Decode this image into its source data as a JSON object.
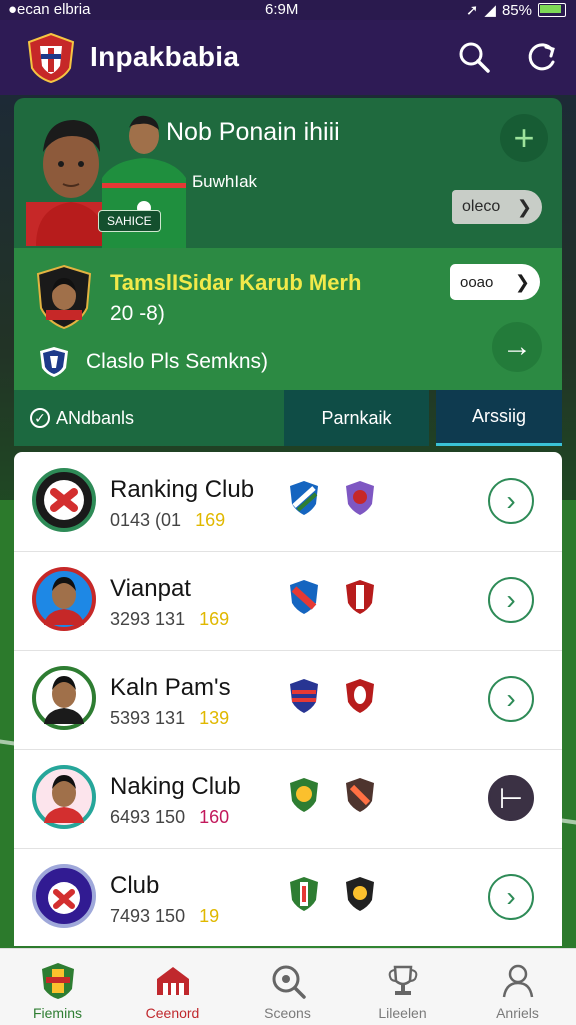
{
  "status_bar": {
    "carrier": "●ecan elbria",
    "time": "6:9M",
    "battery": "85%",
    "battery_level": 0.85
  },
  "app": {
    "title": "Inpakbabia"
  },
  "hero": {
    "title": "Nob Ponain ihiii",
    "subtitle": "ƂuwhIak",
    "player_tag": "SAHICE",
    "pill_label": "oleco"
  },
  "match": {
    "title": "TamslISidar Karub Merh",
    "score": "20 -8)",
    "watch_label": "ooao",
    "league": "Claslo Pls Semkns)"
  },
  "tabs": [
    {
      "label": "ANdbanls"
    },
    {
      "label": "Parnkaik"
    },
    {
      "label": "Arssiig"
    }
  ],
  "rows": [
    {
      "name": "Ranking Club",
      "stat_a": "0143 (01",
      "stat_b": "169",
      "highlight_color": "#e0b800"
    },
    {
      "name": "Vianpat",
      "stat_a": "3293 131",
      "stat_b": "169",
      "highlight_color": "#e0b800"
    },
    {
      "name": "Kaln Pam's",
      "stat_a": "5393 131",
      "stat_b": "139",
      "highlight_color": "#e0b800"
    },
    {
      "name": "Naking Club",
      "stat_a": "6493 150",
      "stat_b": "160",
      "highlight_color": "#c2185b"
    },
    {
      "name": "Club",
      "stat_a": "7493 150",
      "stat_b": "19",
      "highlight_color": "#e0b800"
    }
  ],
  "nav": [
    {
      "label": "Fiemins",
      "icon": "team-badge-icon"
    },
    {
      "label": "Ceenord",
      "icon": "stadium-icon"
    },
    {
      "label": "Sceons",
      "icon": "search-ball-icon"
    },
    {
      "label": "Lileelen",
      "icon": "trophy-icon"
    },
    {
      "label": "Anriels",
      "icon": "profile-icon"
    }
  ],
  "colors": {
    "appbar": "#2e1b55",
    "hero": "#1f6a3e",
    "match": "#2c8a43",
    "accent_yellow": "#f2e94a",
    "arrow_green": "#2e8b57",
    "active_red": "#c0282d"
  }
}
